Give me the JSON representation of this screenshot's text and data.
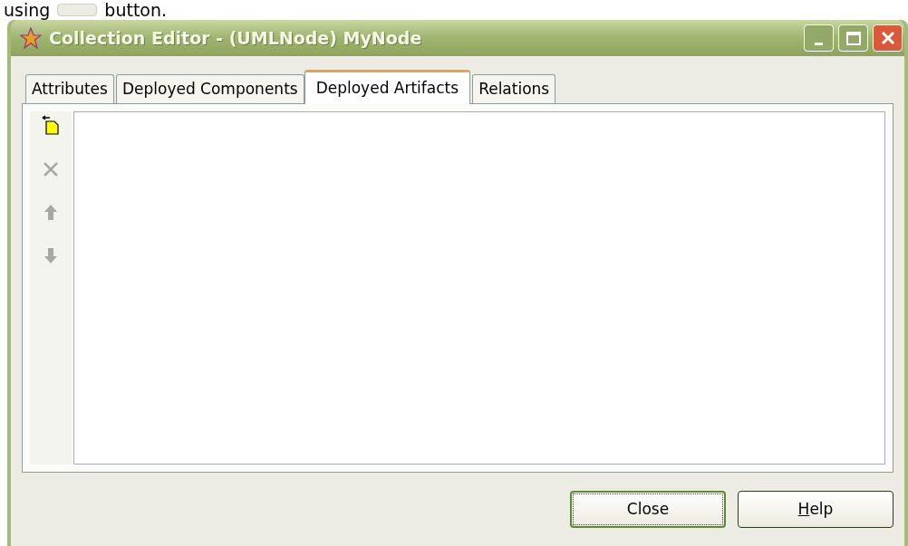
{
  "caption": {
    "before": "using",
    "after": "button."
  },
  "window": {
    "title": "Collection Editor - (UMLNode) MyNode"
  },
  "tabs": [
    {
      "label": "Attributes",
      "selected": false
    },
    {
      "label": "Deployed Components",
      "selected": false
    },
    {
      "label": "Deployed Artifacts",
      "selected": true
    },
    {
      "label": "Relations",
      "selected": false
    }
  ],
  "toolbar": [
    {
      "kind": "new",
      "disabled": false
    },
    {
      "kind": "delete",
      "disabled": true
    },
    {
      "kind": "up",
      "disabled": true
    },
    {
      "kind": "down",
      "disabled": true
    }
  ],
  "buttons": [
    {
      "label": "Close",
      "default": true,
      "mnemonic": false
    },
    {
      "label": "Help",
      "default": false,
      "mnemonic": true
    }
  ]
}
